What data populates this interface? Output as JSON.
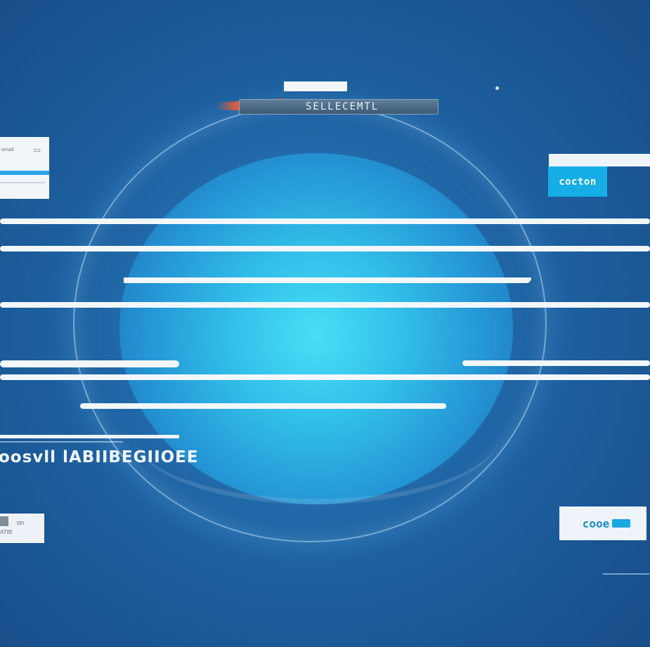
{
  "title_bar": {
    "label": "SELLECEMTL"
  },
  "left_card": {
    "caption": "omad",
    "grid_glyph": "=="
  },
  "right_card": {
    "button_label": "cocton"
  },
  "heading": {
    "text": "oosvll lABIIBEGIIOEE"
  },
  "bottom_left_card": {
    "line1": "on",
    "line2": "ATIB"
  },
  "bottom_right_card": {
    "label": "cooe"
  },
  "colors": {
    "accent_red": "#e35a3a",
    "accent_blue": "#15aee6",
    "background": "#1f64a3",
    "orb": "#48dff6"
  }
}
